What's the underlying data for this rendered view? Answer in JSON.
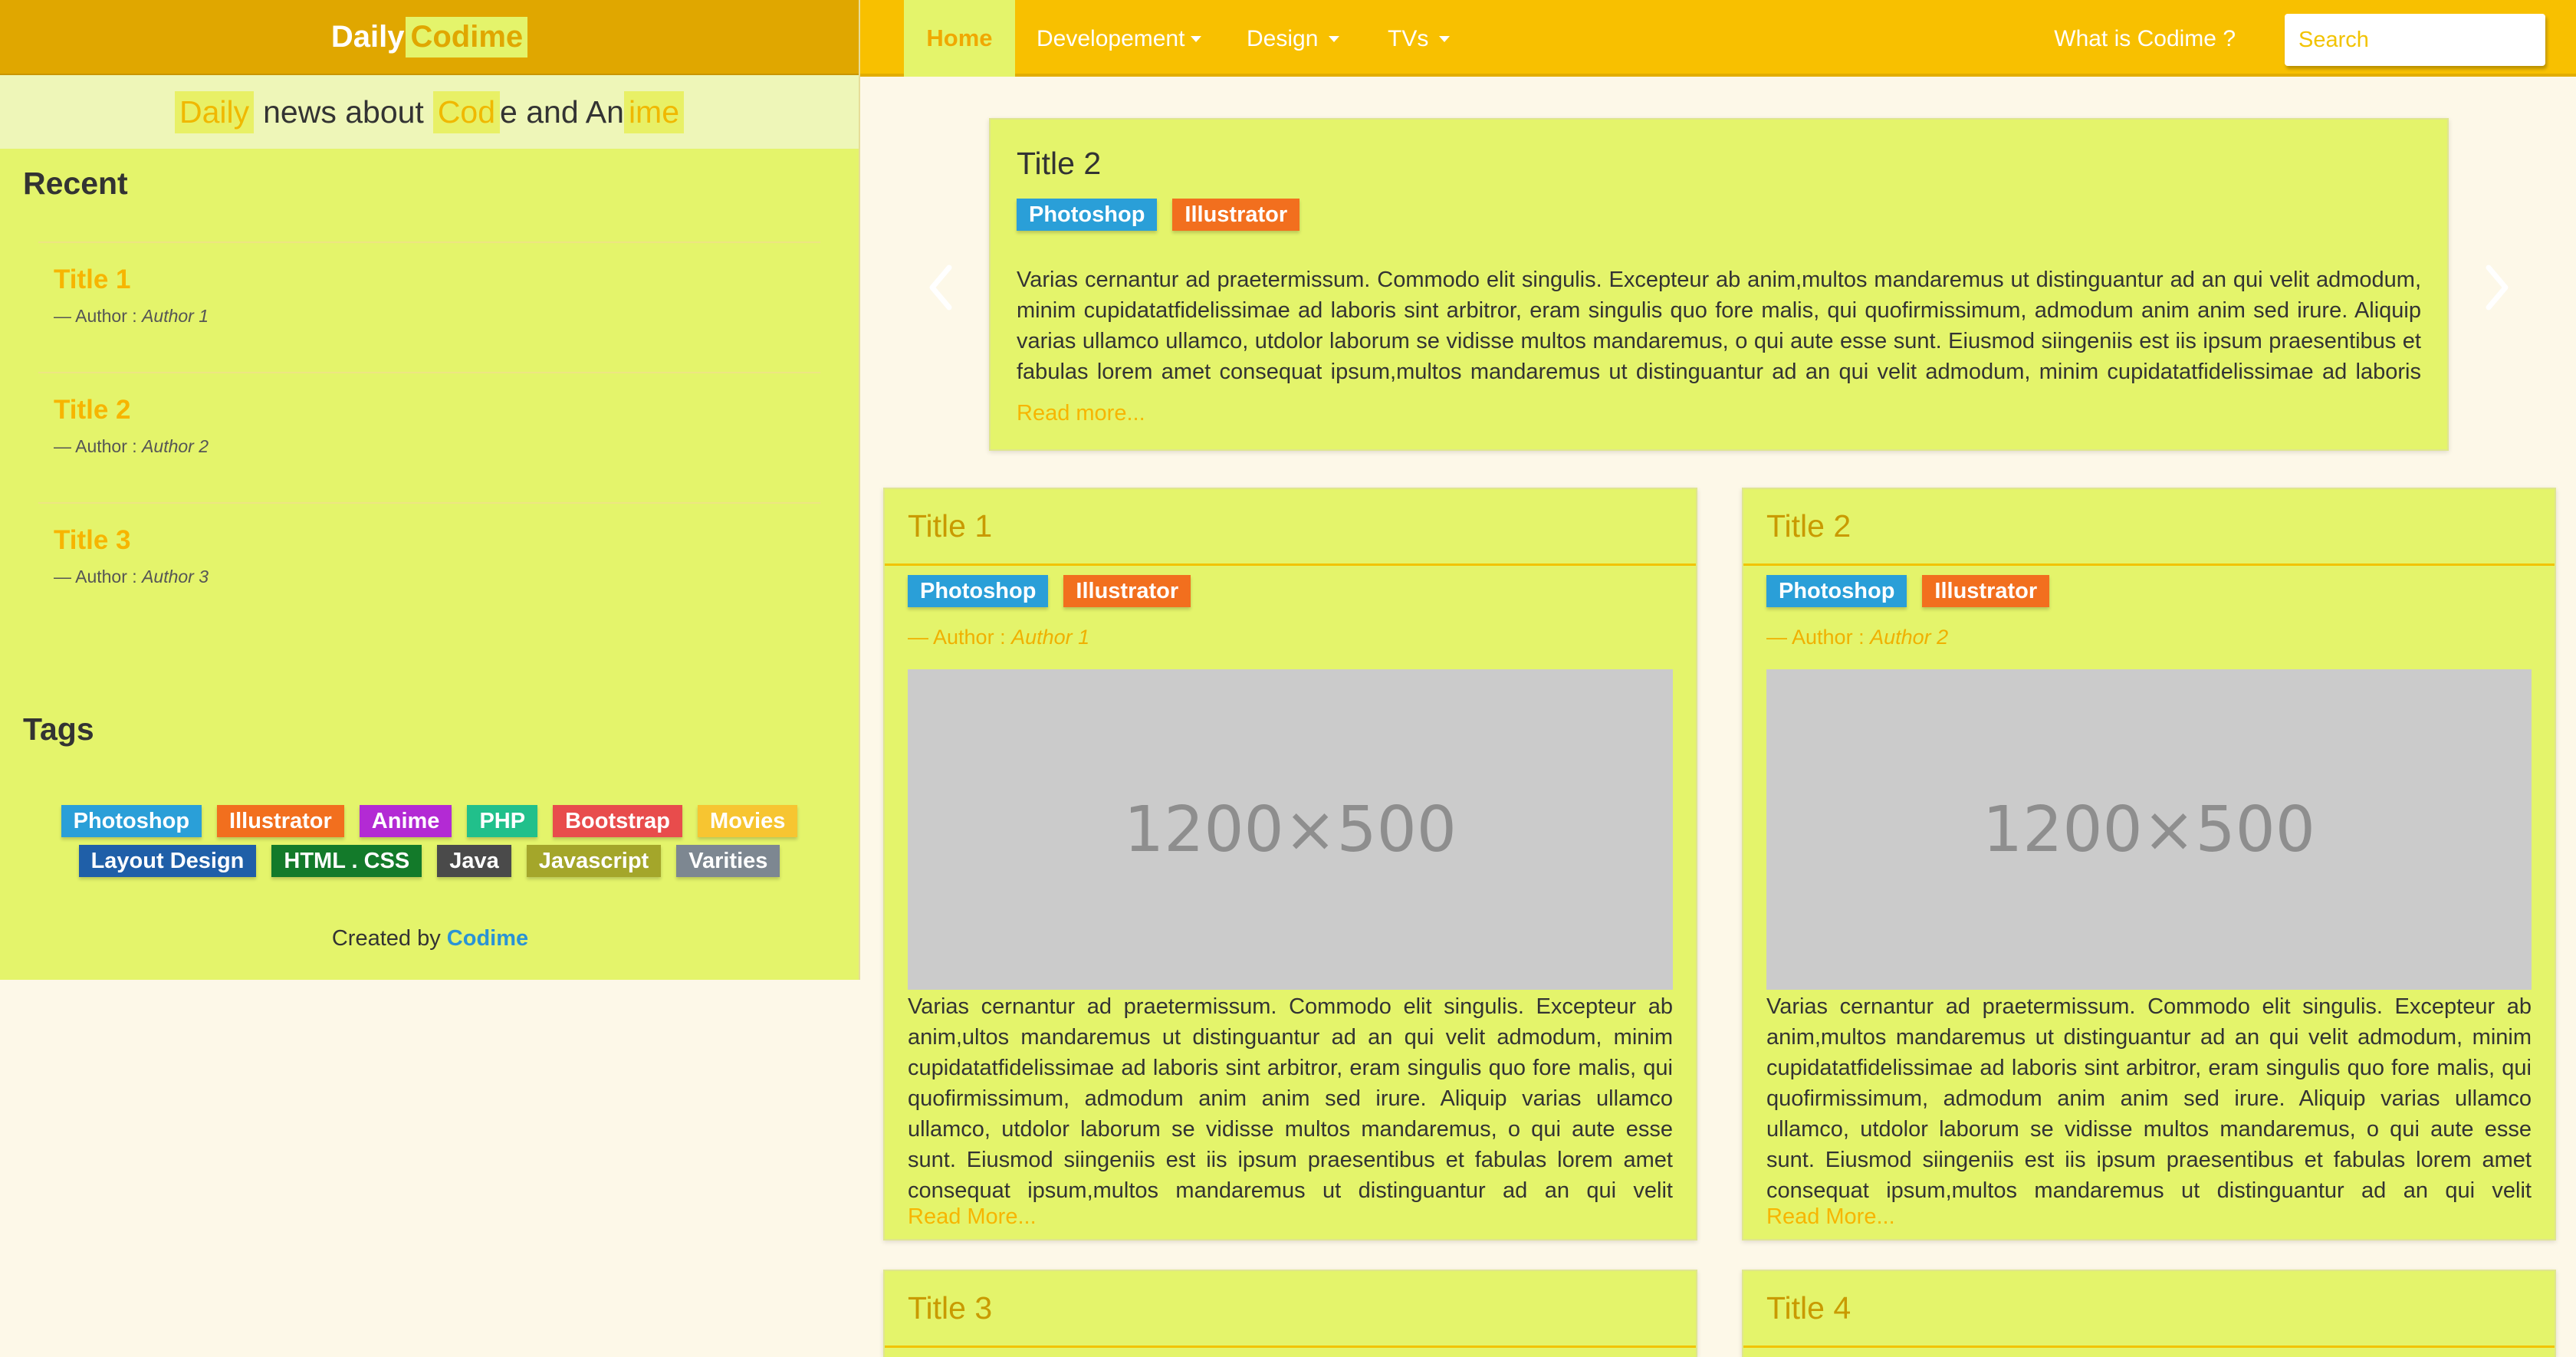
{
  "brand": {
    "prefix": "Daily",
    "highlight": "Codime"
  },
  "tagline": {
    "p1": "Daily",
    "p2": "news about",
    "p3": "Cod",
    "p4": "e and An",
    "p5": "ime"
  },
  "sidebar": {
    "recent_heading": "Recent",
    "recent": [
      {
        "title": "Title 1",
        "author_prefix": "— Author :",
        "author": "Author 1"
      },
      {
        "title": "Title 2",
        "author_prefix": "— Author :",
        "author": "Author 2"
      },
      {
        "title": "Title 3",
        "author_prefix": "— Author :",
        "author": "Author 3"
      }
    ],
    "tags_heading": "Tags",
    "tags": [
      {
        "label": "Photoshop",
        "color": "#2a9fd8"
      },
      {
        "label": "Illustrator",
        "color": "#f26f1e"
      },
      {
        "label": "Anime",
        "color": "#b32ad4"
      },
      {
        "label": "PHP",
        "color": "#21c08b"
      },
      {
        "label": "Bootstrap",
        "color": "#e84c4c"
      },
      {
        "label": "Movies",
        "color": "#f7c531"
      },
      {
        "label": "Layout Design",
        "color": "#1f5fa8"
      },
      {
        "label": "HTML . CSS",
        "color": "#137a2a"
      },
      {
        "label": "Java",
        "color": "#4a4a4a"
      },
      {
        "label": "Javascript",
        "color": "#a4a62a"
      },
      {
        "label": "Varities",
        "color": "#7d8791"
      }
    ],
    "created_prefix": "Created by",
    "created_link": "Codime"
  },
  "nav": {
    "home": "Home",
    "development": "Developement",
    "design": "Design",
    "tvs": "TVs",
    "what": "What is Codime ?",
    "search_placeholder": "Search"
  },
  "labels": {
    "photoshop": {
      "text": "Photoshop",
      "color": "#2a9fd8"
    },
    "illustrator": {
      "text": "Illustrator",
      "color": "#f26f1e"
    }
  },
  "featured": {
    "title": "Title 2",
    "text": "Varias cernantur ad praetermissum. Commodo elit singulis. Excepteur ab anim,multos mandaremus ut distinguantur ad an qui velit admodum, minim cupidatatfidelissimae ad laboris sint arbitror, eram singulis quo fore malis, qui quofirmissimum, admodum anim anim sed irure. Aliquip varias ullamco ullamco, utdolor laborum se vidisse multos mandaremus, o qui aute esse sunt. Eiusmod siingeniis est iis ipsum praesentibus et fabulas lorem amet consequat ipsum,multos mandaremus ut distinguantur ad an qui velit admodum, minim cupidatatfidelissimae ad laboris sint arbitror,",
    "read_more": "Read more..."
  },
  "cards": [
    {
      "title": "Title 1",
      "author_prefix": "— Author :",
      "author": "Author 1",
      "image_text": "1200×500",
      "text": "Varias cernantur ad praetermissum. Commodo elit singulis. Excepteur ab anim,ultos mandaremus ut distinguantur ad an qui velit admodum, minim cupidatatfidelissimae ad laboris sint arbitror, eram singulis quo fore malis, qui quofirmissimum, admodum anim anim sed irure. Aliquip varias ullamco ullamco, utdolor laborum se vidisse multos mandaremus, o qui aute esse sunt. Eiusmod siingeniis est iis ipsum praesentibus et fabulas lorem amet consequat ipsum,multos mandaremus ut distinguantur ad an qui velit admodum, minim",
      "read_more": "Read More..."
    },
    {
      "title": "Title 2",
      "author_prefix": "— Author :",
      "author": "Author 2",
      "image_text": "1200×500",
      "text": "Varias cernantur ad praetermissum. Commodo elit singulis. Excepteur ab anim,multos mandaremus ut distinguantur ad an qui velit admodum, minim cupidatatfidelissimae ad laboris sint arbitror, eram singulis quo fore malis, qui quofirmissimum, admodum anim anim sed irure. Aliquip varias ullamco ullamco, utdolor laborum se vidisse multos mandaremus, o qui aute esse sunt. Eiusmod siingeniis est iis ipsum praesentibus et fabulas lorem amet consequat ipsum,multos mandaremus ut distinguantur ad an qui velit admodum, minim",
      "read_more": "Read More..."
    },
    {
      "title": "Title 3"
    },
    {
      "title": "Title 4"
    }
  ]
}
